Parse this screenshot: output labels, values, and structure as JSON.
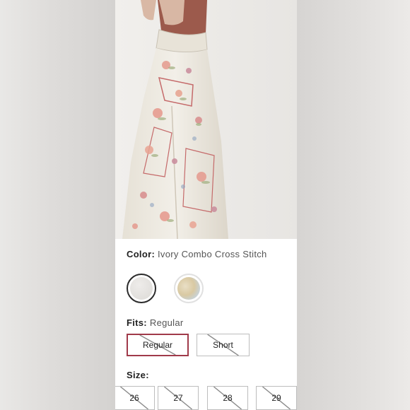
{
  "product": {
    "color_label": "Color:",
    "color_value": "Ivory Combo Cross Stitch",
    "fits_label": "Fits:",
    "fits_value": "Regular",
    "fit_options": [
      "Regular",
      "Short"
    ],
    "size_label": "Size:",
    "sizes": [
      "26",
      "27",
      "28",
      "29"
    ]
  },
  "swatches": [
    {
      "name": "ivory-swatch",
      "color": "#e4e2de",
      "selected": true
    },
    {
      "name": "floral-swatch",
      "color": "#dccfae",
      "selected": false
    }
  ],
  "colors": {
    "selected_border": "#a03a4a",
    "option_border": "#bdbdbd",
    "strike": "#8a8a8a"
  }
}
